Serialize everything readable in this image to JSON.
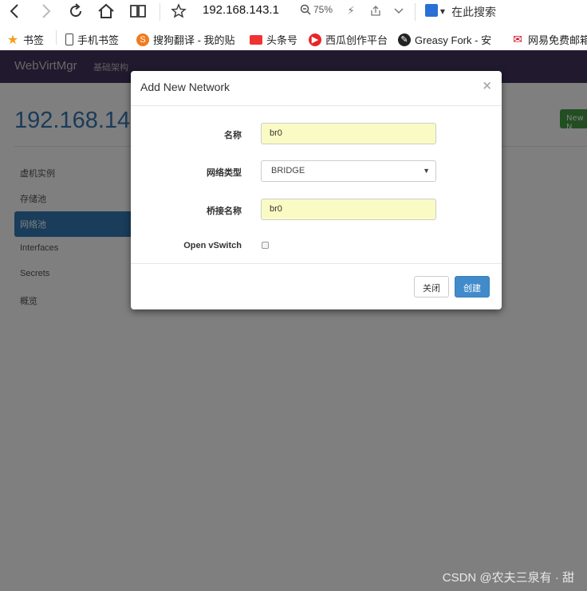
{
  "browser": {
    "url": "192.168.143.1",
    "zoom": "75%",
    "search_label": "在此搜索"
  },
  "bookmarks": [
    {
      "label": "书签"
    },
    {
      "label": "手机书签"
    },
    {
      "label": "搜狗翻译 - 我的贴"
    },
    {
      "label": "头条号"
    },
    {
      "label": "西瓜创作平台"
    },
    {
      "label": "Greasy Fork - 安"
    },
    {
      "label": "网易免费邮箱"
    }
  ],
  "app": {
    "brand": "WebVirtMgr",
    "nav_link": "基础架构",
    "host_title": "192.168.14",
    "new_button": "New N"
  },
  "sidebar": {
    "items": [
      {
        "label": "虚机实例"
      },
      {
        "label": "存储池"
      },
      {
        "label": "网络池"
      },
      {
        "label": "Interfaces"
      },
      {
        "label": "Secrets"
      },
      {
        "label": "概览"
      }
    ]
  },
  "modal": {
    "title": "Add New Network",
    "close_glyph": "×",
    "fields": {
      "name_label": "名称",
      "name_value": "br0",
      "type_label": "网络类型",
      "type_value": "BRIDGE",
      "bridge_label": "桥接名称",
      "bridge_value": "br0",
      "ovs_label": "Open vSwitch"
    },
    "close_button": "关闭",
    "create_button": "创建"
  },
  "watermark": "CSDN @农夫三泉有 · 甜",
  "colors": {
    "navbar": "#43325c",
    "primary": "#428bca",
    "success": "#449d44",
    "autofill": "#fafbc4"
  }
}
